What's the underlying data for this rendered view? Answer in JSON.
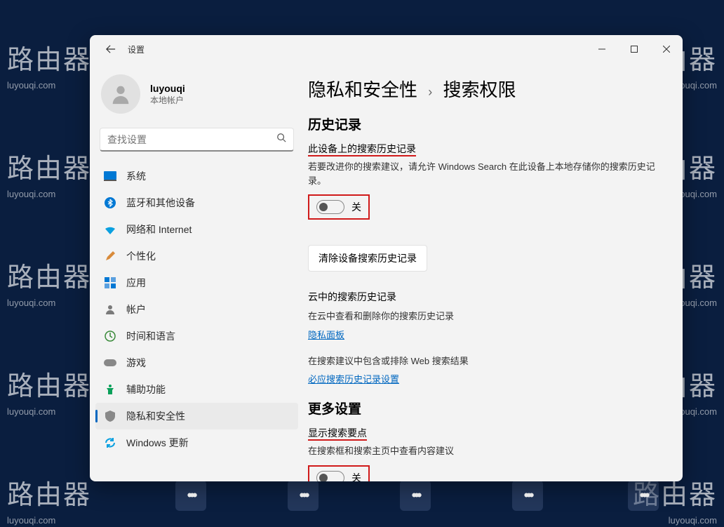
{
  "watermark": {
    "big": "路由器",
    "small": "luyouqi.com"
  },
  "window": {
    "title": "设置",
    "user": {
      "name": "luyouqi",
      "sub": "本地帐户"
    },
    "search_placeholder": "查找设置",
    "nav": [
      {
        "label": "系统"
      },
      {
        "label": "蓝牙和其他设备"
      },
      {
        "label": "网络和 Internet"
      },
      {
        "label": "个性化"
      },
      {
        "label": "应用"
      },
      {
        "label": "帐户"
      },
      {
        "label": "时间和语言"
      },
      {
        "label": "游戏"
      },
      {
        "label": "辅助功能"
      },
      {
        "label": "隐私和安全性"
      },
      {
        "label": "Windows 更新"
      }
    ],
    "content": {
      "breadcrumb_a": "隐私和安全性",
      "breadcrumb_b": "搜索权限",
      "sec_history": "历史记录",
      "device_history_head": "此设备上的搜索历史记录",
      "device_history_desc": "若要改进你的搜索建议，请允许 Windows Search 在此设备上本地存储你的搜索历史记录。",
      "toggle_off": "关",
      "clear_btn": "清除设备搜索历史记录",
      "cloud_head": "云中的搜索历史记录",
      "cloud_desc": "在云中查看和删除你的搜索历史记录",
      "privacy_link": "隐私面板",
      "web_desc": "在搜索建议中包含或排除 Web 搜索结果",
      "bing_link": "必应搜索历史记录设置",
      "sec_more": "更多设置",
      "highlights_head": "显示搜索要点",
      "highlights_desc": "在搜索框和搜索主页中查看内容建议"
    }
  }
}
